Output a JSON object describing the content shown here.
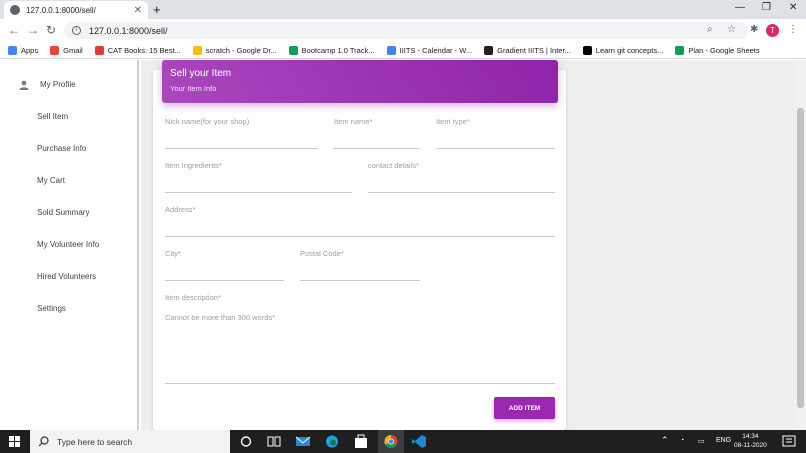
{
  "browser": {
    "tab_title": "127.0.0.1:8000/sell/",
    "url": "127.0.0.1:8000/sell/",
    "avatar_letter": "T",
    "bookmarks": [
      {
        "label": "Apps",
        "color": "#4285f4"
      },
      {
        "label": "Gmail",
        "color": "#ea4335"
      },
      {
        "label": "CAT Books: 15 Best...",
        "color": "#e53935"
      },
      {
        "label": "scratch - Google Dr...",
        "color": "#fbbc04"
      },
      {
        "label": "Bootcamp 1.0 Track...",
        "color": "#0f9d58"
      },
      {
        "label": "IIITS - Calendar - W...",
        "color": "#4285f4"
      },
      {
        "label": "Gradient IIITS | Inter...",
        "color": "#202124"
      },
      {
        "label": "Learn git concepts...",
        "color": "#000000"
      },
      {
        "label": "Plan - Google Sheets",
        "color": "#0f9d58"
      }
    ]
  },
  "sidebar": {
    "items": [
      {
        "label": "My Profile"
      },
      {
        "label": "Sell Item"
      },
      {
        "label": "Purchase Info"
      },
      {
        "label": "My Cart"
      },
      {
        "label": "Sold Summary"
      },
      {
        "label": "My Volunteer Info"
      },
      {
        "label": "Hired Volunteers"
      },
      {
        "label": "Settings"
      }
    ]
  },
  "form": {
    "title": "Sell your Item",
    "subtitle": "Your Item Info",
    "fields": {
      "nickname": "Nick name(for your shop)",
      "item_name": "Item name*",
      "item_type": "Item type*",
      "ingredients": "Item Ingredients*",
      "contact": "contact details*",
      "address": "Address*",
      "city": "City*",
      "postal": "Postal Code*",
      "description": "Item description*",
      "description_placeholder": "Cannot be more than 300 words*"
    },
    "submit_label": "ADD ITEM",
    "accent_color": "#9c27b0"
  },
  "taskbar": {
    "search_placeholder": "Type here to search",
    "language": "ENG",
    "time": "14:34",
    "date": "08-11-2020"
  }
}
